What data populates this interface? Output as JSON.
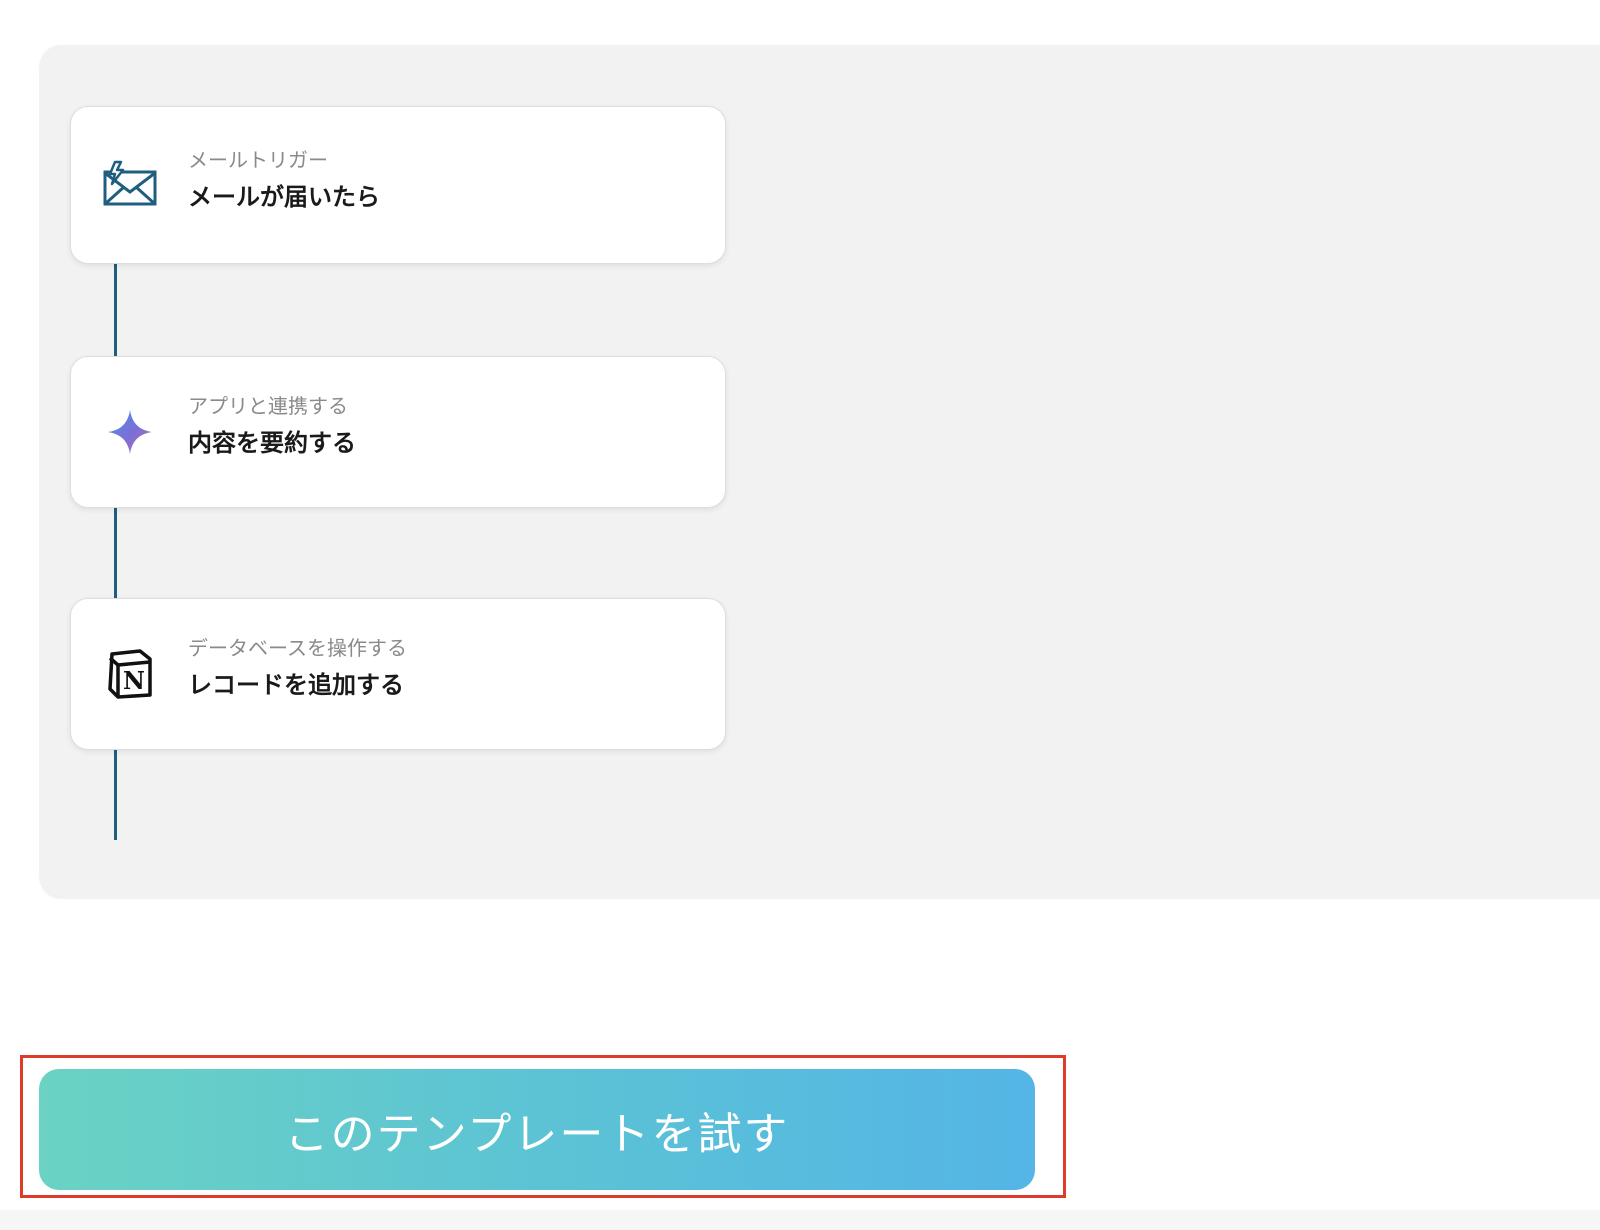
{
  "flow": {
    "steps": [
      {
        "category": "メールトリガー",
        "title": "メールが届いたら",
        "icon": "mail-trigger-icon"
      },
      {
        "category": "アプリと連携する",
        "title": "内容を要約する",
        "icon": "ai-sparkle-icon"
      },
      {
        "category": "データベースを操作する",
        "title": "レコードを追加する",
        "icon": "notion-icon"
      }
    ]
  },
  "cta": {
    "label": "このテンプレートを試す"
  },
  "colors": {
    "connector": "#1f5e7e",
    "panel_background": "#f2f2f2",
    "cta_gradient_start": "#6bd2c4",
    "cta_gradient_end": "#54b5e6",
    "highlight_border": "#e03a2a"
  }
}
